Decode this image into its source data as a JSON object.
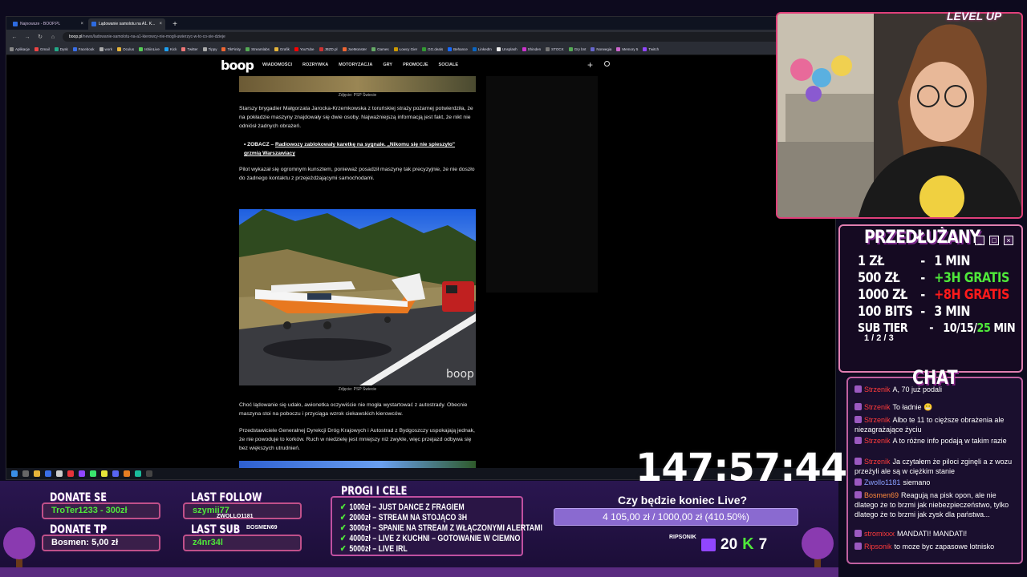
{
  "browser": {
    "tabs": [
      {
        "label": "Najnowsze - BOOP.PL",
        "active": false
      },
      {
        "label": "Lądowanie samolotu na A1. K...",
        "active": true
      }
    ],
    "url_domain": "boop.pl",
    "url_path": "/news/ladowanie-samolotu-na-a1-kierowcy-nie-mogli-uwierzyc-w-to-co-sie-dzieje",
    "bookmarks": [
      "Aplikacje",
      "Gmail",
      "Dysk",
      "Facebook",
      "work",
      "Oculus",
      "IshiinLive",
      "Kick",
      "Twitter",
      "Tippy",
      "TikFinity",
      "Streamlabs",
      "Grafik",
      "YouTube",
      "JBZD.pl",
      "JoeMonster",
      "Games",
      "Łowcy Gier",
      "GG.deals",
      "Behance",
      "LinkedIn",
      "Unsplash",
      "Shinden",
      "STOCK",
      "Gry bnt",
      "Norwegia",
      "Memory 5",
      "Twitch"
    ]
  },
  "site": {
    "logo": "boop",
    "nav": [
      "WIADOMOŚCI",
      "ROZRYWKA",
      "MOTORYZACJA",
      "GRY",
      "PROMOCJE",
      "SOCIALE"
    ]
  },
  "article": {
    "caption1": "Zdjęcie: PSP Świecie",
    "para1": "Starszy brygadier Małgorzata Jarocka-Krzemkowska z toruńskiej straży pożarnej potwierdziła, że na pokładzie maszyny znajdowały się dwie osoby. Najważniejszą informacją jest fakt, że nikt nie odniósł żadnych obrażeń.",
    "bullet_prefix": "ZOBACZ – ",
    "bullet_link": "Radiowozy zablokowały karetkę na sygnale. „Nikomu się nie spieszyło\" grzmią Warszawiacy",
    "para2": "Pilot wykazał się ogromnym kunsztem, ponieważ posadził maszynę tak precyzyjnie, że nie doszło do żadnego kontaktu z przejeżdżającymi samochodami.",
    "caption2": "Zdjęcie: PSP Świecie",
    "photo_watermark": "boop",
    "para3": "Choć lądowanie się udało, awionetka oczywiście nie mogła wystartować z autostrady. Obecnie maszyna stoi na poboczu i przyciąga wzrok ciekawskich kierowców.",
    "para4": "Przedstawiciele Generalnej Dyrekcji Dróg Krajowych i Autostrad z Bydgoszczy uspokajają jednak, że nie powoduje to korków. Ruch w niedzielę jest mniejszy niż zwykle, więc przejazd odbywa się bez większych utrudnień."
  },
  "overlay": {
    "level_logo": "LEVEL UP",
    "extend": {
      "title": "PRZEDŁUŻANY",
      "rows": [
        {
          "amount": "1 ZŁ",
          "value": "1 MIN",
          "color": "#ffffff"
        },
        {
          "amount": "500 ZŁ",
          "value": "+3H GRATIS",
          "color": "#4fe83a"
        },
        {
          "amount": "1000 ZŁ",
          "value": "+8H GRATIS",
          "color": "#ff1a1a"
        },
        {
          "amount": "100 BITS",
          "value": "3 MIN",
          "color": "#ffffff"
        }
      ],
      "sub_label": "SUB TIER",
      "sub_tiers": "1 / 2 / 3",
      "sub_value_prefix": "10/15/",
      "sub_value_highlight": "25",
      "sub_value_suffix": " MIN"
    },
    "chat": {
      "title": "CHAT",
      "messages": [
        {
          "user": "Strzenik",
          "text": "A, 70 już podali",
          "color": "red"
        },
        {
          "user": "Strzenik",
          "text": "To ładnie 😬",
          "color": "red"
        },
        {
          "user": "Strzenik",
          "text": "Albo te 11 to cięższe obrażenia ale niezagrażające życiu",
          "color": "red"
        },
        {
          "user": "Strzenik",
          "text": "A to różne info podają w takim razie",
          "color": "red"
        },
        {
          "user": "Strzenik",
          "text": "Ja czytałem że piloci zginęli a z wozu przeżyli ale są w ciężkim stanie",
          "color": "red"
        },
        {
          "user": "Zwollo1181",
          "text": "siemano",
          "color": "blue"
        },
        {
          "user": "Bosmen69",
          "text": "Reagują na pisk opon, ale nie dlatego że to brzmi jak niebezpieczeństwo, tylko dlatego że to brzmi jak zysk dla państwa...",
          "color": "gold"
        },
        {
          "user": "stromixxx",
          "text": "MANDATI! MANDATI!",
          "color": "red"
        },
        {
          "user": "Ripsonik",
          "text": "to moze byc zapasowe lotnisko",
          "color": "red"
        }
      ]
    },
    "timer": "147:57:44",
    "donate_se": {
      "title": "DONATE SE",
      "value": "TroTer1233 - 300zł"
    },
    "donate_tp": {
      "title": "DONATE TP",
      "value": "Bosmen: 5,00 zł"
    },
    "last_follow": {
      "title": "LAST FOLLOW",
      "value": "szymii77",
      "overlay_name": "ZWOLLO1181"
    },
    "last_sub": {
      "title": "LAST SUB",
      "value": "z4nr34l",
      "overlay_name": "BOSMEN69"
    },
    "goals": {
      "title": "PROGI I CELE",
      "items": [
        "1000zł – JUST DANCE Z FRAGIEM",
        "2000zł – STREAM NA STOJĄCO 3H",
        "3000zł – SPANIE NA STREAM Z WŁĄCZONYMI ALERTAMI",
        "4000zł – LIVE Z KUCHNI – GOTOWANIE W CIEMNO",
        "5000zł – LIVE IRL"
      ]
    },
    "question": "Czy będzie koniec Live?",
    "progress_text": "4 105,00 zł / 1000,00 zł (410.50%)",
    "progress_fraction": 1.0,
    "ripsonik_label": "RIPSONIK",
    "twitch_count": "20",
    "kick_count": "7",
    "colors": {
      "accent": "#c0508a",
      "green": "#4fe83a",
      "red": "#ff1a1a",
      "purple": "#9146ff"
    }
  }
}
